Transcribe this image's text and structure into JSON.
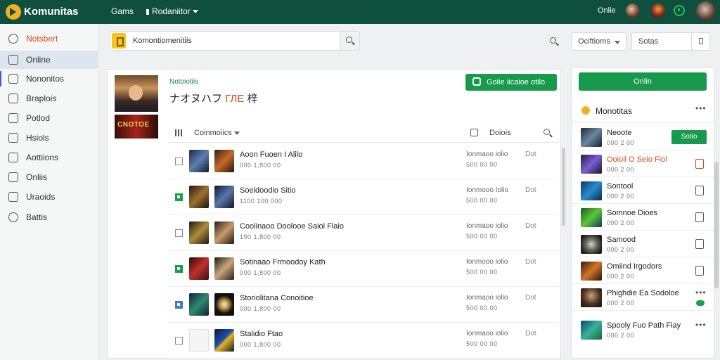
{
  "topbar": {
    "brand": "Komunitas",
    "nav_games": "Gams",
    "nav_dropdown": "Rodaniitor",
    "status": "Onlie"
  },
  "sidebar": {
    "items": [
      {
        "label": "Notsbert"
      },
      {
        "label": "Online"
      },
      {
        "label": "Nononitos"
      },
      {
        "label": "Braplois"
      },
      {
        "label": "Potlod"
      },
      {
        "label": "Hsiols"
      },
      {
        "label": "Aottiions"
      },
      {
        "label": "Onliis"
      },
      {
        "label": "Uraoids"
      },
      {
        "label": "Battis"
      }
    ]
  },
  "search": {
    "value": "Komontiomenitiis"
  },
  "filters": {
    "sort_label": "Ociftioms",
    "status_label": "Sotas"
  },
  "game": {
    "cover_text": "CNOTOE",
    "kicker": "Notoiotiis",
    "title_main": "ナオヌハフ",
    "title_accent": "ГЛЕ",
    "title_tail": "梓",
    "action_label": "Goiie iicaioe otilo"
  },
  "toolbar": {
    "select_label": "Coinmoiics",
    "status_label": "Doiois"
  },
  "rows": [
    {
      "title": "Aoon Fuoen I Alilo",
      "sub": "000 1,800 00",
      "stat": "Ionmaoo iolio",
      "stat2": "500 00 00",
      "col": "Dot"
    },
    {
      "title": "Soeldoodio Sitio",
      "sub": "1100 100 000",
      "stat": "Ionmooo Iolio",
      "stat2": "500 00 00",
      "col": "Dot"
    },
    {
      "title": "Coolinaoo Doolooe Saiol  Flaio",
      "sub": "100 1,800 00",
      "stat": "Ionmaoo iolio",
      "stat2": "500 00 00",
      "col": "Dot"
    },
    {
      "title": "Sotinaao  Frmoodoy  Kath",
      "sub": "000 1,800 00",
      "stat": "Ionmooo iolio",
      "stat2": "500 00 00",
      "col": "Dot"
    },
    {
      "title": "Storiolitana  Conoitioe",
      "sub": "000 1,800 00",
      "stat": "Ionmaoo iolio",
      "stat2": "500 00 00",
      "col": "Dot"
    },
    {
      "title": "Stalidio Ftao",
      "sub": "000 1,800 00",
      "stat": "Ionmaoo iolio",
      "stat2": "500 00 00",
      "col": "Dot"
    }
  ],
  "rpanel": {
    "online_button": "Onlin",
    "header": "Monotitas",
    "friends": [
      {
        "name": "Neoote",
        "sub": "000 2 00",
        "button": "Sotio"
      },
      {
        "name": "Ooioil O Seio Fiol",
        "sub": "000 2 00"
      },
      {
        "name": "Sontool",
        "sub": "000 2 00"
      },
      {
        "name": "Somnoe Dioes",
        "sub": "000 2 00"
      },
      {
        "name": "Samood",
        "sub": "000 2 00"
      },
      {
        "name": "Omiind  Irgodors",
        "sub": "000 2 00"
      },
      {
        "name": "Phighdie Ea Sodoloe",
        "sub": "000 2 00"
      },
      {
        "name": "Spooly  Fuo  Path Fiay",
        "sub": "000 2 00"
      }
    ]
  }
}
